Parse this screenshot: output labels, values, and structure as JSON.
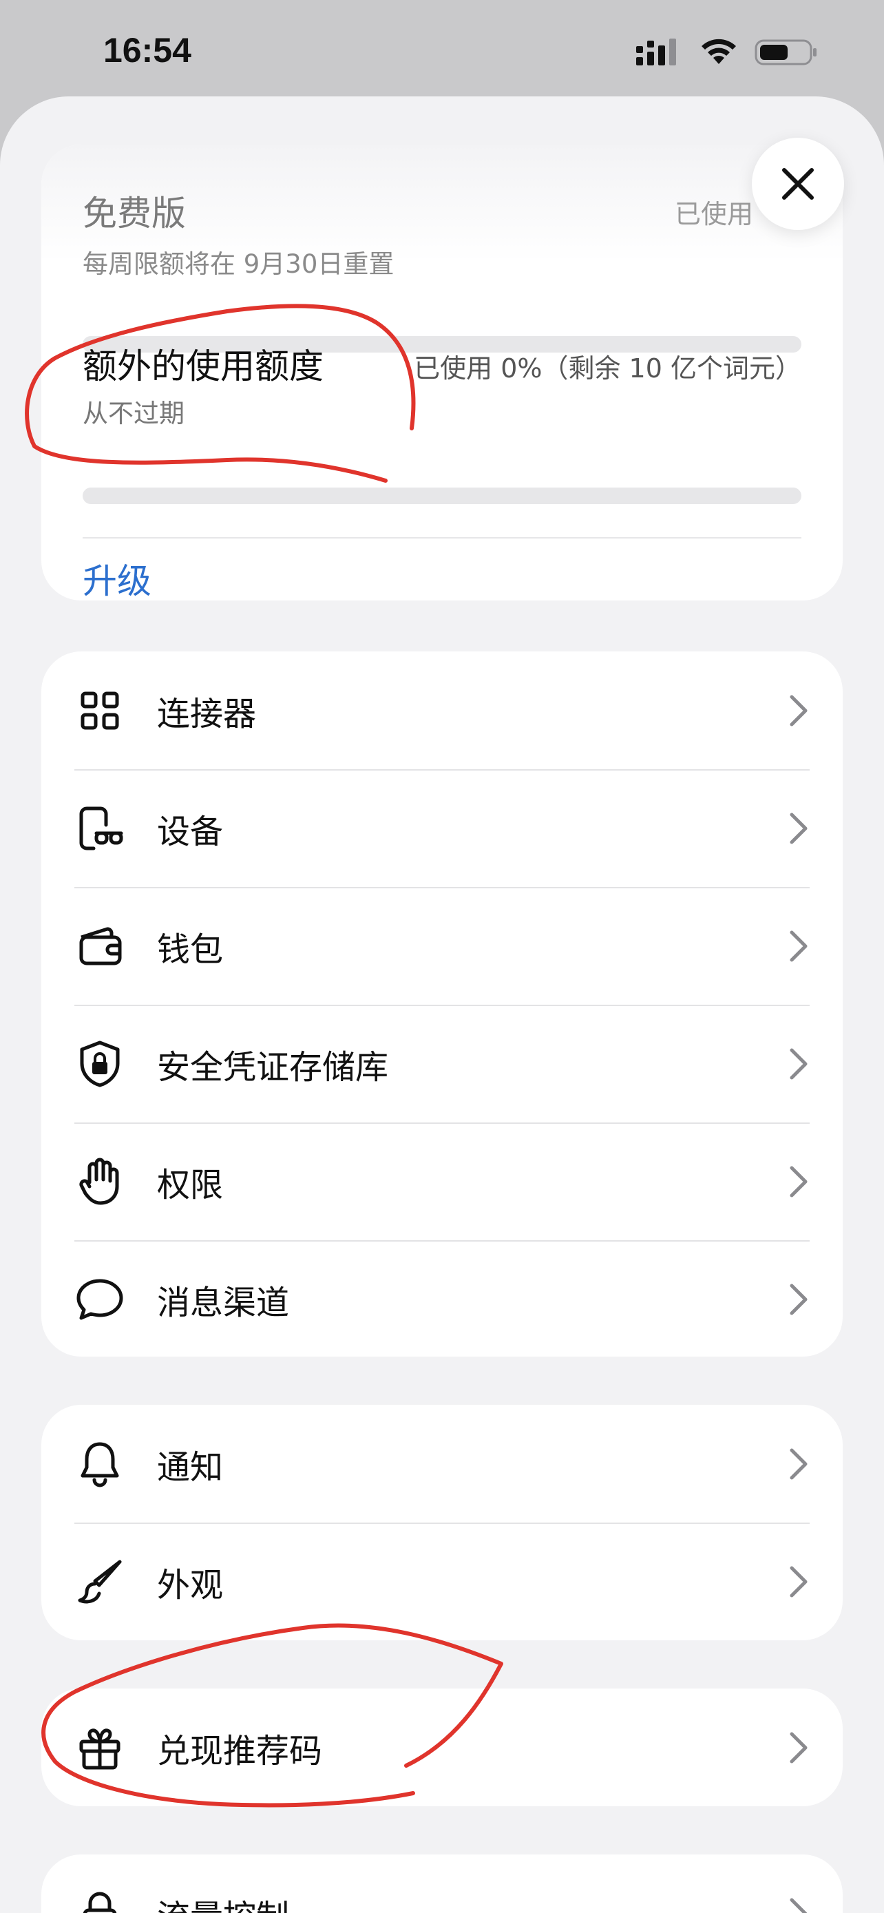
{
  "status_bar": {
    "time": "16:54"
  },
  "plan": {
    "name": "免费版",
    "used_label": "已使用",
    "reset_note": "每周限额将在 9月30日重置",
    "usage_fraction": 0
  },
  "extra_quota": {
    "title": "额外的使用额度",
    "used_label": "已使用 0%（剩余 10 亿个词元）",
    "subtitle": "从不过期",
    "usage_fraction": 0
  },
  "upgrade_label": "升级",
  "menu_group_1": [
    {
      "label": "连接器",
      "icon": "grid-icon"
    },
    {
      "label": "设备",
      "icon": "phone-glasses-icon"
    },
    {
      "label": "钱包",
      "icon": "wallet-icon"
    },
    {
      "label": "安全凭证存储库",
      "icon": "shield-lock-icon"
    },
    {
      "label": "权限",
      "icon": "hand-icon"
    },
    {
      "label": "消息渠道",
      "icon": "chat-bubble-icon"
    }
  ],
  "menu_group_2": [
    {
      "label": "通知",
      "icon": "bell-icon"
    },
    {
      "label": "外观",
      "icon": "paintbrush-icon"
    }
  ],
  "menu_group_3": [
    {
      "label": "兑现推荐码",
      "icon": "gift-icon"
    }
  ],
  "menu_group_4": [
    {
      "label": "流量控制",
      "icon": "lock-icon"
    }
  ],
  "colors": {
    "accent_link": "#2c6fce",
    "annotation_red": "#e0342c",
    "sheet_bg": "#f2f2f4",
    "card_bg": "#ffffff"
  }
}
